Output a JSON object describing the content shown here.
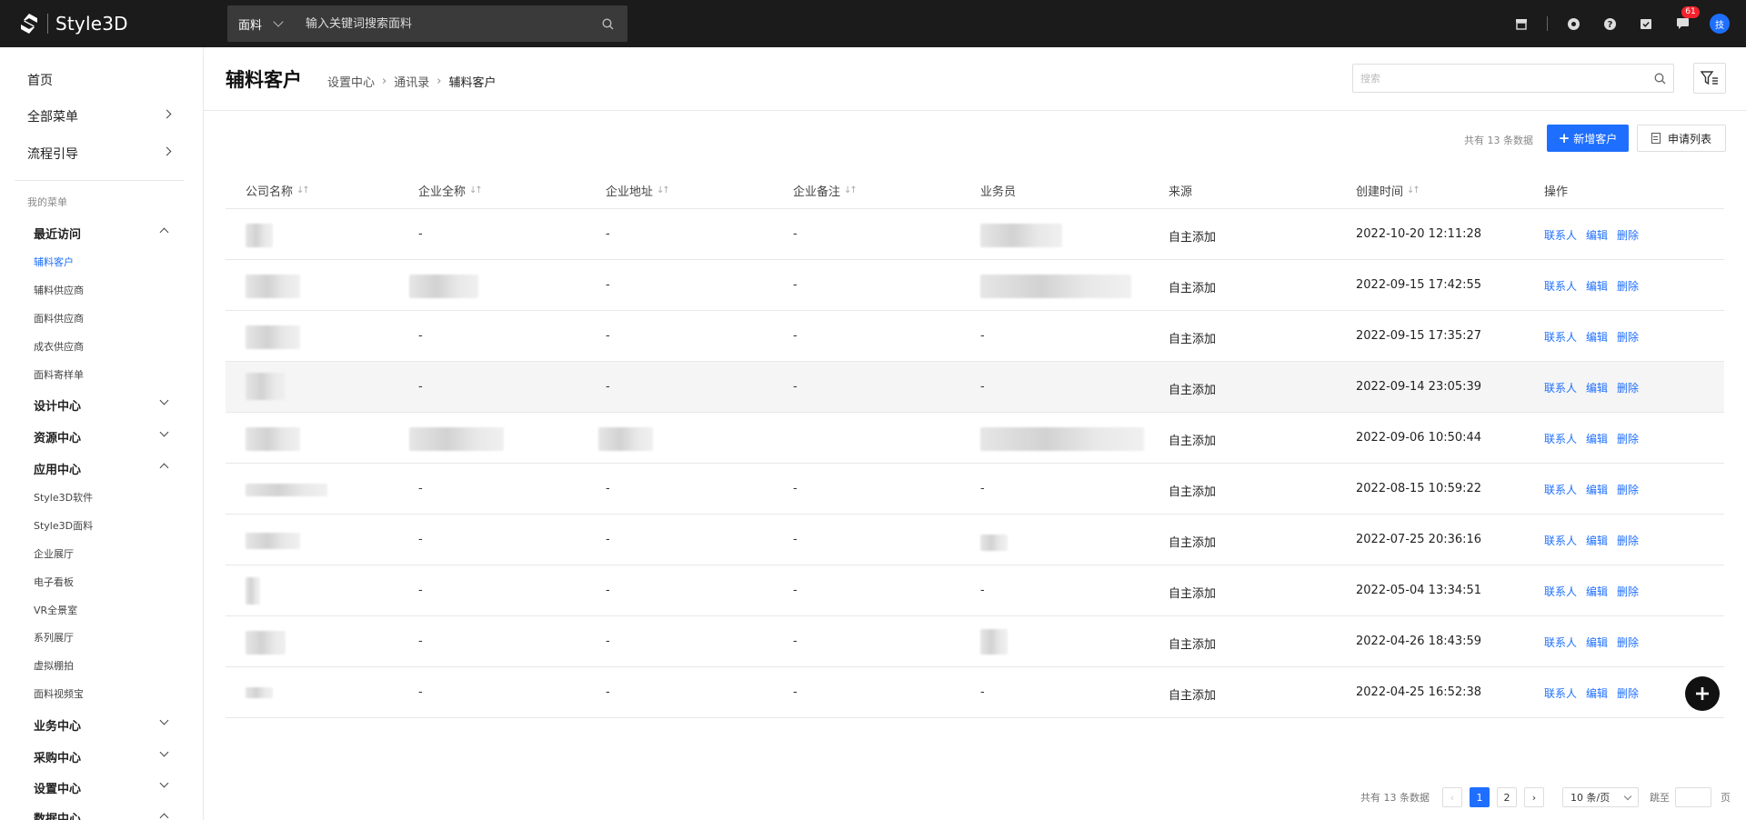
{
  "brand": {
    "logo_text": "Style3D"
  },
  "top_search": {
    "category": "面料",
    "placeholder": "输入关键词搜索面料"
  },
  "top_icons": {
    "message_badge": "61",
    "avatar_text": "技"
  },
  "sidebar": {
    "home": "首页",
    "all_menu": "全部菜单",
    "process_guide": "流程引导",
    "my_menu_label": "我的菜单",
    "groups": [
      {
        "label": "最近访问",
        "expanded": true,
        "items": [
          "辅料客户",
          "辅料供应商",
          "面料供应商",
          "成衣供应商",
          "面料寄样单"
        ]
      },
      {
        "label": "设计中心",
        "expanded": false
      },
      {
        "label": "资源中心",
        "expanded": false
      },
      {
        "label": "应用中心",
        "expanded": true,
        "items": [
          "Style3D软件",
          "Style3D面料",
          "企业展厅",
          "电子看板",
          "VR全景室",
          "系列展厅",
          "虚拟棚拍",
          "面料视频宝"
        ]
      },
      {
        "label": "业务中心",
        "expanded": false
      },
      {
        "label": "采购中心",
        "expanded": false
      },
      {
        "label": "设置中心",
        "expanded": false
      },
      {
        "label": "数据中心",
        "expanded": true
      }
    ],
    "active_item": "辅料客户"
  },
  "header": {
    "title": "辅料客户",
    "breadcrumb": [
      "设置中心",
      "通讯录",
      "辅料客户"
    ],
    "search_placeholder": "搜索"
  },
  "toolbar": {
    "total_text": "共有 13 条数据",
    "add_label": "新增客户",
    "list_label": "申请列表"
  },
  "table": {
    "columns": [
      "公司名称",
      "企业全称",
      "企业地址",
      "企业备注",
      "业务员",
      "来源",
      "创建时间",
      "操作"
    ],
    "rows": [
      {
        "full_name": "",
        "address": "-",
        "remark": "-",
        "sales": "",
        "source": "自主添加",
        "created": "2022-10-20 12:11:28"
      },
      {
        "full_name": "",
        "address": "-",
        "remark": "-",
        "sales": "",
        "source": "自主添加",
        "created": "2022-09-15 17:42:55"
      },
      {
        "full_name": "-",
        "address": "-",
        "remark": "-",
        "sales": "-",
        "source": "自主添加",
        "created": "2022-09-15 17:35:27"
      },
      {
        "full_name": "-",
        "address": "-",
        "remark": "-",
        "sales": "-",
        "source": "自主添加",
        "created": "2022-09-14 23:05:39"
      },
      {
        "full_name": "",
        "address": "",
        "remark": "",
        "sales": "",
        "source": "自主添加",
        "created": "2022-09-06 10:50:44"
      },
      {
        "full_name": "-",
        "address": "-",
        "remark": "-",
        "sales": "-",
        "source": "自主添加",
        "created": "2022-08-15 10:59:22"
      },
      {
        "full_name": "-",
        "address": "-",
        "remark": "-",
        "sales": "",
        "source": "自主添加",
        "created": "2022-07-25 20:36:16"
      },
      {
        "full_name": "-",
        "address": "-",
        "remark": "-",
        "sales": "-",
        "source": "自主添加",
        "created": "2022-05-04 13:34:51"
      },
      {
        "full_name": "-",
        "address": "-",
        "remark": "-",
        "sales": "",
        "source": "自主添加",
        "created": "2022-04-26 18:43:59"
      },
      {
        "full_name": "-",
        "address": "-",
        "remark": "-",
        "sales": "-",
        "source": "自主添加",
        "created": "2022-04-25 16:52:38"
      }
    ],
    "ops": [
      "联系人",
      "编辑",
      "删除"
    ]
  },
  "pagination": {
    "total_text": "共有 13 条数据",
    "pages": [
      "1",
      "2"
    ],
    "current": "1",
    "page_size": "10 条/页",
    "jump_label": "跳至",
    "page_unit": "页"
  }
}
